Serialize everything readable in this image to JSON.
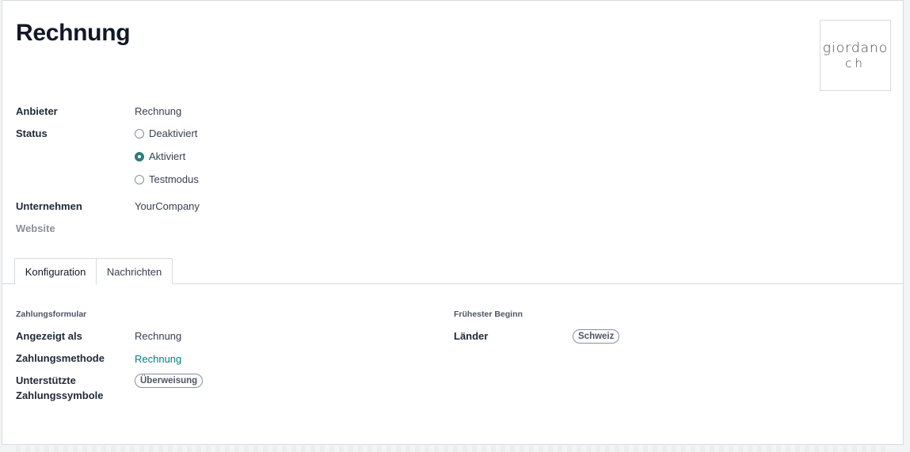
{
  "record": {
    "title": "Rechnung",
    "logo_line1": "giordano",
    "logo_line2": "ch"
  },
  "fields": {
    "provider_label": "Anbieter",
    "provider_value": "Rechnung",
    "status_label": "Status",
    "status_options": [
      {
        "label": "Deaktiviert",
        "checked": false
      },
      {
        "label": "Aktiviert",
        "checked": true
      },
      {
        "label": "Testmodus",
        "checked": false
      }
    ],
    "company_label": "Unternehmen",
    "company_value": "YourCompany",
    "website_label": "Website"
  },
  "tabs": [
    {
      "label": "Konfiguration",
      "active": true
    },
    {
      "label": "Nachrichten",
      "active": false
    }
  ],
  "config": {
    "payment_form_title": "Zahlungsformular",
    "displayed_as_label": "Angezeigt als",
    "displayed_as_value": "Rechnung",
    "payment_method_label": "Zahlungsmethode",
    "payment_method_value": "Rechnung",
    "supported_symbols_label_line1": "Unterstützte",
    "supported_symbols_label_line2": "Zahlungssymbole",
    "supported_symbols_tag": "Überweisung",
    "earliest_start_title": "Frühester Beginn",
    "countries_label": "Länder",
    "countries_tag": "Schweiz"
  },
  "colors": {
    "accent": "#2c7f7a",
    "link": "#017e84",
    "border": "#d8dadd"
  }
}
